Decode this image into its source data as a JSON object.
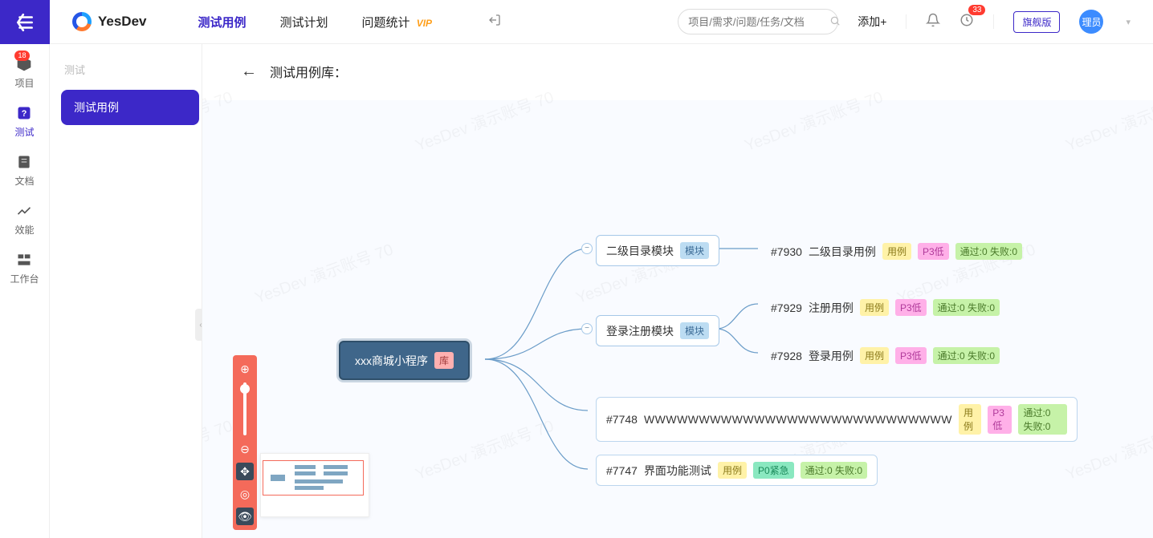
{
  "brand": "YesDev",
  "nav": {
    "items": [
      {
        "label": "测试用例",
        "active": true
      },
      {
        "label": "测试计划",
        "active": false
      },
      {
        "label": "问题统计",
        "active": false
      }
    ],
    "vip": "VIP"
  },
  "search": {
    "placeholder": "项目/需求/问题/任务/文档"
  },
  "header": {
    "add": "添加+",
    "clock_badge": "33",
    "plan_button": "旗舰版",
    "avatar": "理员"
  },
  "rail": {
    "items": [
      {
        "key": "project",
        "label": "项目",
        "badge": "18"
      },
      {
        "key": "test",
        "label": "测试",
        "active": true
      },
      {
        "key": "doc",
        "label": "文档"
      },
      {
        "key": "metric",
        "label": "效能"
      },
      {
        "key": "workbench",
        "label": "工作台"
      }
    ]
  },
  "side2": {
    "section": "测试",
    "item": "测试用例"
  },
  "main": {
    "crumb_title": "测试用例库："
  },
  "watermark": "YesDev 演示账号 70",
  "mindmap": {
    "root": {
      "title": "xxx商城小程序",
      "tag": "库"
    },
    "modules": [
      {
        "title": "二级目录模块",
        "tag": "模块"
      },
      {
        "title": "登录注册模块",
        "tag": "模块"
      }
    ],
    "cases": [
      {
        "id": "#7930",
        "title": "二级目录用例",
        "case_tag": "用例",
        "prio": "P3低",
        "prio_class": "tag-p3",
        "stat": "通过:0 失败:0"
      },
      {
        "id": "#7929",
        "title": "注册用例",
        "case_tag": "用例",
        "prio": "P3低",
        "prio_class": "tag-p3",
        "stat": "通过:0 失败:0"
      },
      {
        "id": "#7928",
        "title": "登录用例",
        "case_tag": "用例",
        "prio": "P3低",
        "prio_class": "tag-p3",
        "stat": "通过:0 失败:0"
      },
      {
        "id": "#7748",
        "title": "WWWWWWWWWWWWWWWWWWWWWWWWWWWW",
        "case_tag": "用例",
        "prio": "P3低",
        "prio_class": "tag-p3",
        "stat": "通过:0 失败:0"
      },
      {
        "id": "#7747",
        "title": "界面功能测试",
        "case_tag": "用例",
        "prio": "P0紧急",
        "prio_class": "tag-p0",
        "stat": "通过:0 失败:0"
      }
    ]
  }
}
